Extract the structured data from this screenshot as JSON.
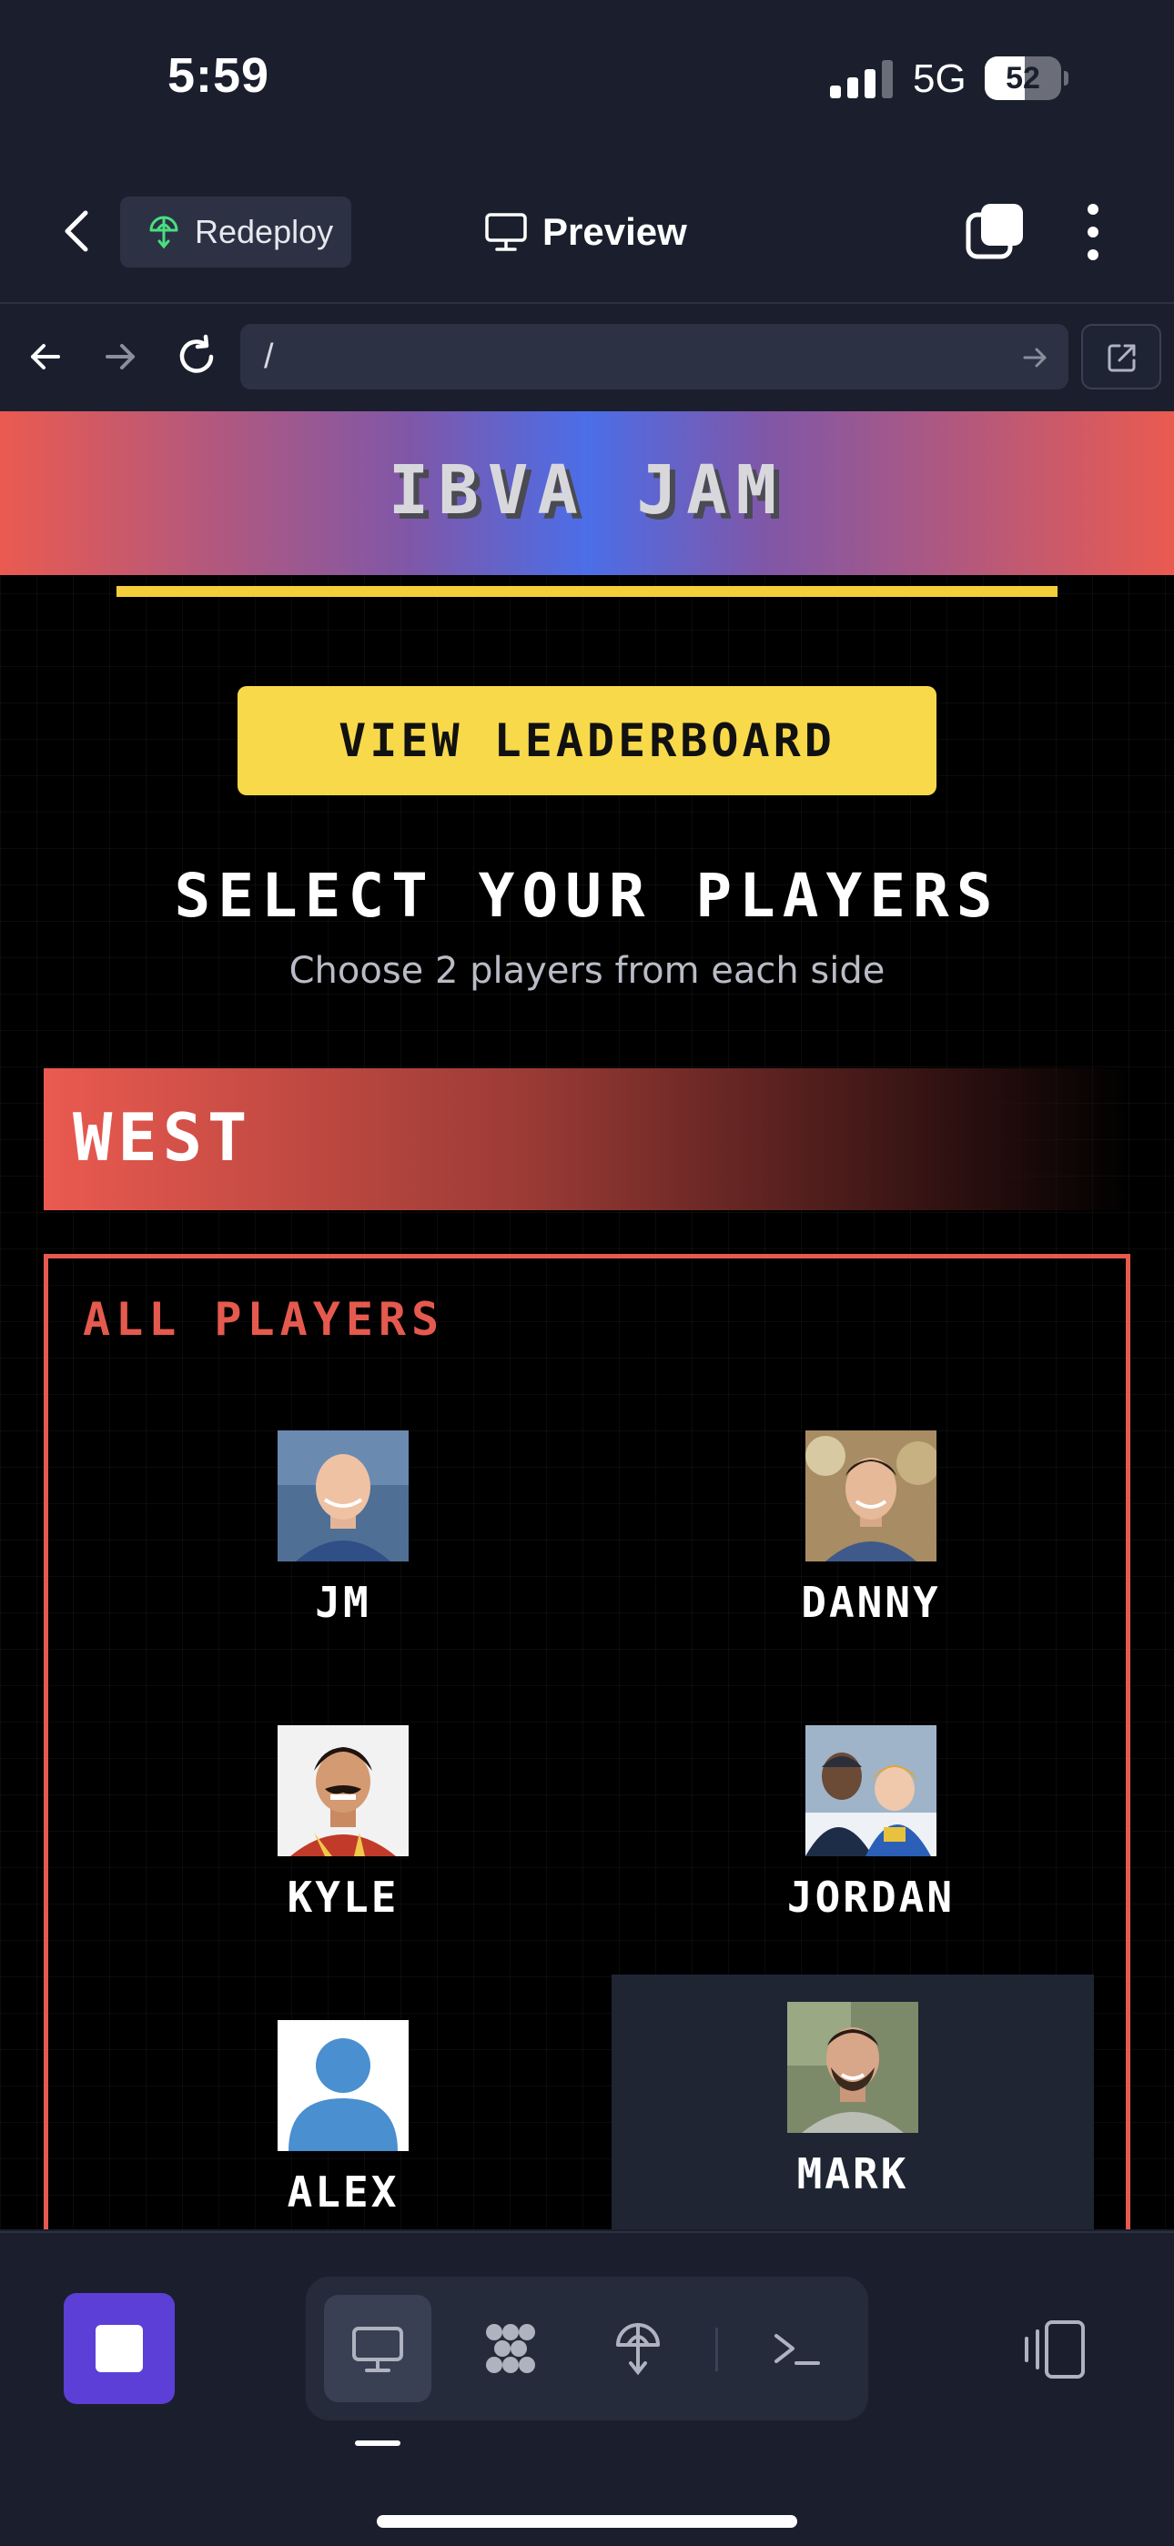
{
  "status_bar": {
    "time": "5:59",
    "network": "5G",
    "battery_level": "52",
    "battery_fraction": 0.52
  },
  "app_bar": {
    "redeploy_label": "Redeploy",
    "preview_label": "Preview",
    "icons": [
      "chevron-left-icon",
      "deploy-icon",
      "monitor-icon",
      "tabs-icon",
      "more-vertical-icon"
    ]
  },
  "browser": {
    "url": "/",
    "icons": [
      "arrow-left-icon",
      "arrow-right-icon",
      "reload-icon",
      "arrow-right-icon",
      "external-link-icon"
    ]
  },
  "site": {
    "title": "IBVA JAM",
    "leaderboard_button": "VIEW LEADERBOARD",
    "heading": "SELECT YOUR PLAYERS",
    "subtitle": "Choose 2 players from each side",
    "team": "WEST",
    "panel_heading": "ALL PLAYERS",
    "players": [
      {
        "name": "JM",
        "selected": false
      },
      {
        "name": "DANNY",
        "selected": false
      },
      {
        "name": "KYLE",
        "selected": false
      },
      {
        "name": "JORDAN",
        "selected": false
      },
      {
        "name": "ALEX",
        "selected": false
      },
      {
        "name": "MARK",
        "selected": true
      }
    ],
    "colors": {
      "accent_yellow": "#f7d94a",
      "west_red": "#e55a4e",
      "header_blue": "#4b6ee8"
    }
  },
  "toolbar": {
    "items": [
      "stop-icon",
      "monitor-icon",
      "agent-icon",
      "deploy-icon",
      "terminal-icon",
      "devices-icon"
    ],
    "active": "monitor-icon"
  }
}
